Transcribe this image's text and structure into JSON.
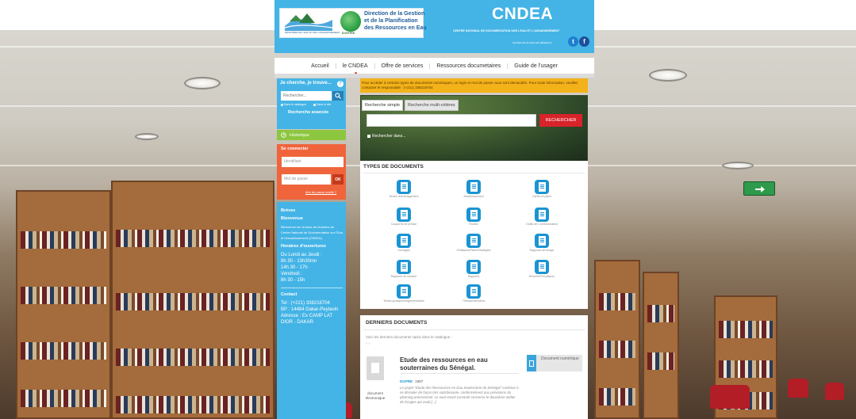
{
  "header": {
    "logo_text": "Direction de la Gestion et de la Planification des Ressources en Eau",
    "logo_acronym": "DGPRE",
    "logo_subtitle": "MINISTÈRE DE L'EAU ET DE L'ASSAINISSEMENT",
    "title": "CNDEA",
    "subtitle": "CENTRE NATIONAL DE DOCUMENTATION SUR L'EAU ET L'ASSAINISSEMENT",
    "follow_label": "SUIVEZ-NOUS SUR LES RÉSEAUX",
    "twitter_glyph": "t",
    "facebook_glyph": "f"
  },
  "nav": {
    "items": [
      {
        "label": "Accueil"
      },
      {
        "label": "le CNDEA"
      },
      {
        "label": "Offre de services"
      },
      {
        "label": "Ressources documetaires"
      },
      {
        "label": "Guide de l'usager"
      }
    ]
  },
  "sidebar": {
    "search_title": "Je cherche, je trouve...",
    "search_placeholder": "Rechercher...",
    "radio_catalogue": "Dans le catalogue",
    "radio_site": "Dans le site",
    "advanced_search": "Recherche avancée",
    "history_label": "Historique",
    "login_title": "Se connecter",
    "username_placeholder": "Identifiant",
    "password_placeholder": "Mot de passe",
    "ok_label": "OK",
    "forgot_password": "Mot de passe oublié ?",
    "info": {
      "breves_title": "Brèves",
      "bienvenue_title": "Bienvenue",
      "bienvenue_text": "Bienvenue sur la base de données du Centre National de Documentation sur l'Eau et l'Assainissement (CNDEA)",
      "horaires_title": "Horaires d'ouvertures",
      "horaires_days": "Du Lundi au Jeudi :",
      "horaires_1": "8h 30 - 13h30mn",
      "horaires_2": "14h 30 - 17h",
      "horaires_days_2": "Vendredi :",
      "horaires_3": "8h 30 - 15h",
      "contact_title": "Contact",
      "contact_tel": "Tel : (+221) 338218704",
      "contact_bp": "BP : 14484 Dakar-Peytavin",
      "contact_addr": "Adresse : Ex CAMP LAT DIOR - DAKAR"
    }
  },
  "notice": {
    "text": "Pour accéder à certains types de documents numériques, un login et mot de passe vous sont demandés. Pour toute information, veuillez contacter le responsable : (+221) 338218704"
  },
  "search": {
    "tab_simple": "Recherche simple",
    "tab_multi": "Recherche multi-critères",
    "button_label": "RECHERCHER",
    "search_in": "Rechercher dans..."
  },
  "types": {
    "title": "TYPES DE DOCUMENTS",
    "items": [
      {
        "label": "Textes d'aménagement"
      },
      {
        "label": "Assainissement"
      },
      {
        "label": "Cartes et plans"
      },
      {
        "label": "Coupures de presse"
      },
      {
        "label": "Études"
      },
      {
        "label": "Outils de Communication"
      },
      {
        "label": "Ouvrages"
      },
      {
        "label": "Politiques/Plans/Stratégies"
      },
      {
        "label": "Rapports de forage"
      },
      {
        "label": "Rapports de mission"
      },
      {
        "label": "Rapports"
      },
      {
        "label": "Revues/Périodiques"
      },
      {
        "label": "Textes juridiques/règlementaires"
      },
      {
        "label": "Thèses/mémoires"
      }
    ]
  },
  "latest": {
    "title": "DERNIERS DOCUMENTS",
    "intro": "Voici les derniers documents saisis dans le catalogue :",
    "feed_glyph": "≡ ≡",
    "record": {
      "title": "Etude des ressources en eau souterraines du Sénégal.",
      "date_key": "DGPRE",
      "date_val": "1987",
      "abstract": "Le projet \"Etude des Ressources en Eau Souterraine du Sénégal\" continue à se dérouler de façon très satisfaisante, conformément aux prévisions du planning prévisionnel. Le seul retard constaté concerne le deuxième atelier de forages qui avait [...]",
      "doc_type": "document électronique",
      "badge": "Document numérique"
    }
  }
}
